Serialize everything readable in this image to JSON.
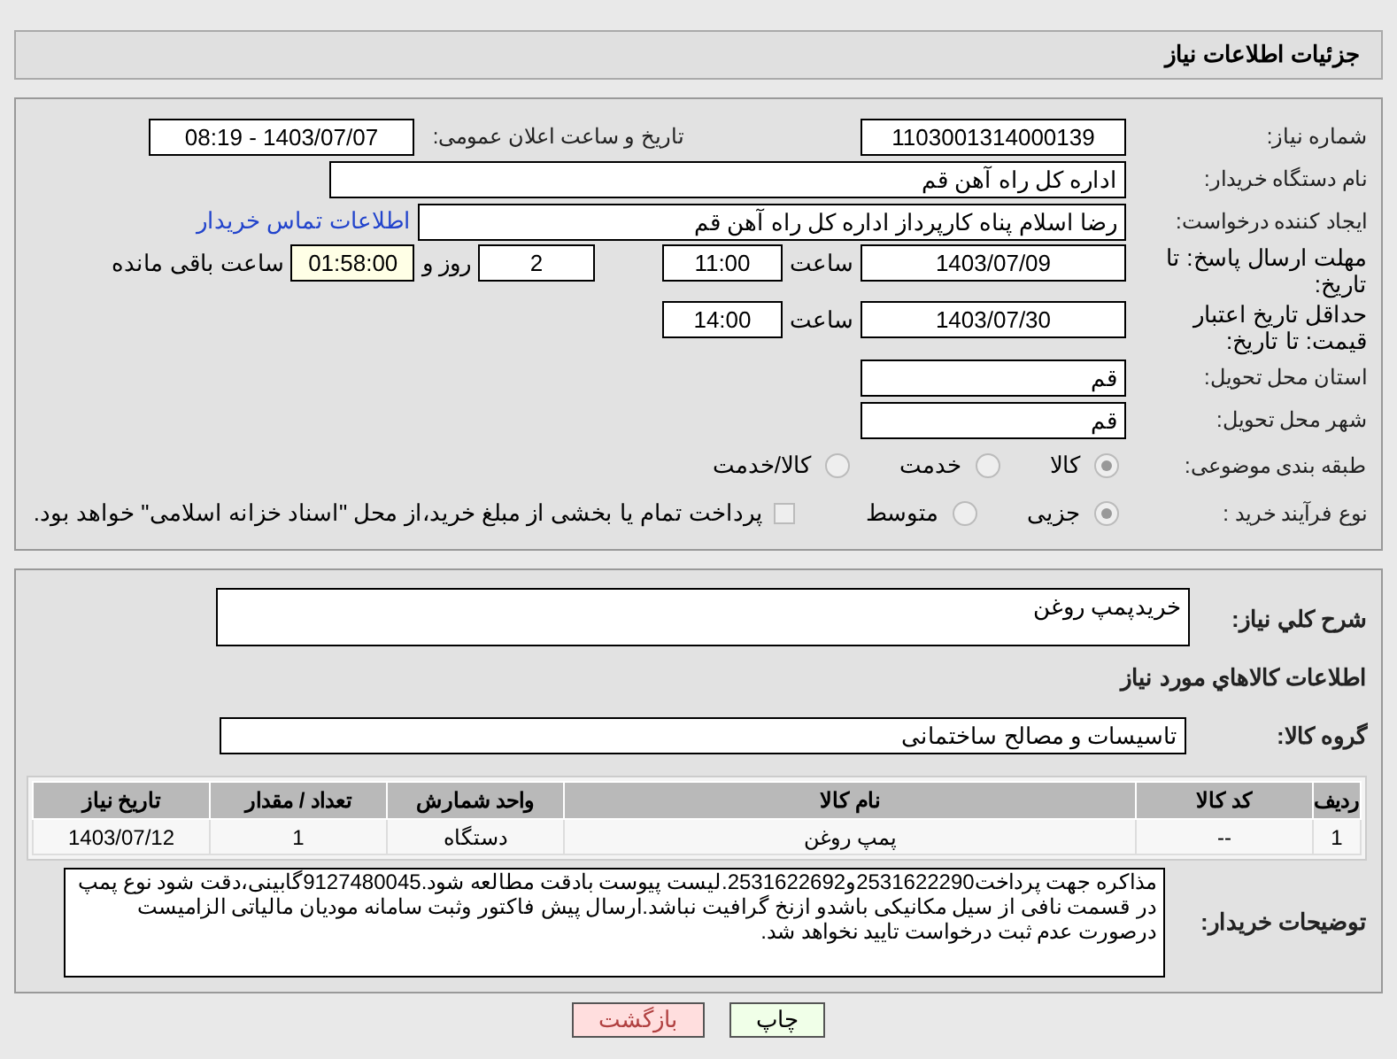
{
  "header": {
    "title": "جزئیات اطلاعات نیاز"
  },
  "need_number": {
    "label": "شماره نیاز:",
    "value": "1103001314000139"
  },
  "announce_date": {
    "label": "تاریخ و ساعت اعلان عمومی:",
    "value": "1403/07/07 - 08:19"
  },
  "buyer_org": {
    "label": "نام دستگاه خریدار:",
    "value": "اداره کل  راه آهن قم"
  },
  "creator": {
    "label": "ایجاد کننده درخواست:",
    "value": "رضا اسلام پناه کارپرداز اداره کل  راه آهن قم",
    "link": "اطلاعات تماس خریدار"
  },
  "response_deadline": {
    "label": "مهلت ارسال پاسخ: تا تاریخ:",
    "date": "1403/07/09",
    "time_label": "ساعت",
    "time": "11:00",
    "days": "2",
    "days_label": "روز و",
    "remaining": "01:58:00",
    "remaining_label": "ساعت باقی مانده"
  },
  "price_validity": {
    "label": "حداقل تاریخ اعتبار قیمت: تا تاریخ:",
    "date": "1403/07/30",
    "time_label": "ساعت",
    "time": "14:00"
  },
  "province": {
    "label": "استان محل تحویل:",
    "value": "قم"
  },
  "city": {
    "label": "شهر محل تحویل:",
    "value": "قم"
  },
  "classification": {
    "label": "طبقه بندی موضوعی:",
    "options": [
      {
        "label": "کالا",
        "selected": true
      },
      {
        "label": "خدمت",
        "selected": false
      },
      {
        "label": "کالا/خدمت",
        "selected": false
      }
    ]
  },
  "purchase_type": {
    "label": "نوع فرآیند خرید :",
    "options": [
      {
        "label": "جزیی",
        "selected": true
      },
      {
        "label": "متوسط",
        "selected": false
      }
    ],
    "treasury": {
      "checked": false,
      "text": "پرداخت تمام یا بخشی از مبلغ خرید،از محل \"اسناد خزانه اسلامی\" خواهد بود."
    }
  },
  "description": {
    "label": "شرح کلي نياز:",
    "value": "خریدپمپ روغن"
  },
  "goods_heading": "اطلاعات کالاهاي مورد نياز",
  "goods_group": {
    "label": "گروه کالا:",
    "value": "تاسیسات و مصالح ساختمانی"
  },
  "table": {
    "columns": [
      "ردیف",
      "کد کالا",
      "نام کالا",
      "واحد شمارش",
      "تعداد / مقدار",
      "تاریخ نیاز"
    ],
    "rows": [
      [
        "1",
        "--",
        "پمپ روغن",
        "دستگاه",
        "1",
        "1403/07/12"
      ]
    ]
  },
  "buyer_notes": {
    "label": "توضیحات خریدار:",
    "value": "مذاکره جهت پرداخت2531622290و2531622692.لیست پیوست بادقت مطالعه شود.9127480045گابینی،دقت شود نوع پمپ در قسمت نافی از سیل مکانیکی باشدو ازنخ گرافیت نباشد.ارسال پیش فاکتور وثبت سامانه مودیان مالیاتی الزامیست درصورت عدم ثبت درخواست تایید نخواهد شد."
  },
  "buttons": [
    {
      "kind": "print",
      "label": "چاپ"
    },
    {
      "kind": "back",
      "label": "بازگشت"
    }
  ]
}
